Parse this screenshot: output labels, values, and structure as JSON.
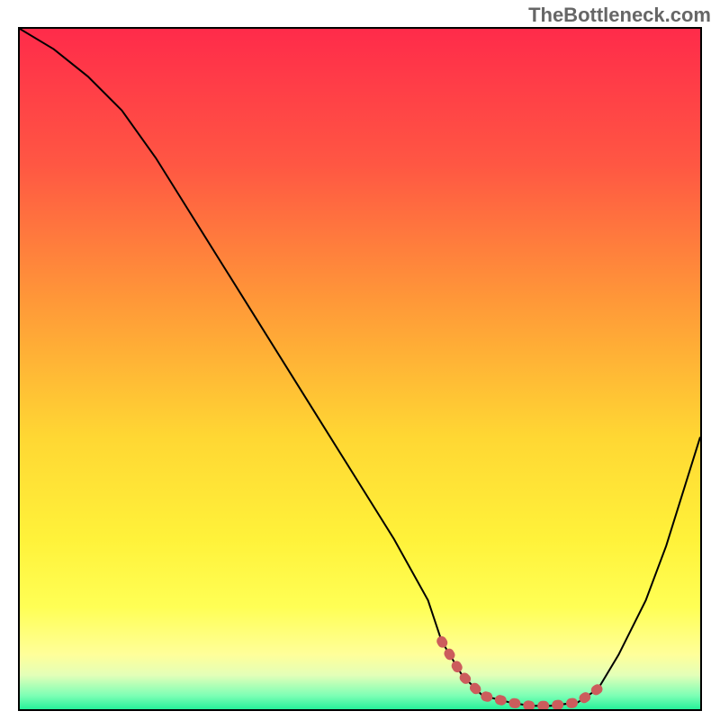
{
  "watermark": "TheBottleneck.com",
  "chart_data": {
    "type": "line",
    "title": "",
    "xlabel": "",
    "ylabel": "",
    "xlim": [
      0,
      100
    ],
    "ylim": [
      0,
      100
    ],
    "series": [
      {
        "name": "bottleneck-curve",
        "x": [
          0,
          5,
          10,
          15,
          20,
          25,
          30,
          35,
          40,
          45,
          50,
          55,
          60,
          62,
          65,
          68,
          72,
          75,
          78,
          82,
          85,
          88,
          92,
          95,
          100
        ],
        "values": [
          100,
          97,
          93,
          88,
          81,
          73,
          65,
          57,
          49,
          41,
          33,
          25,
          16,
          10,
          5,
          2,
          1,
          0.5,
          0.5,
          1,
          3,
          8,
          16,
          24,
          40
        ],
        "color": "#000000"
      },
      {
        "name": "optimal-zone",
        "x": [
          62,
          65,
          68,
          72,
          75,
          78,
          82,
          85
        ],
        "values": [
          10,
          5,
          2,
          1,
          0.5,
          0.5,
          1,
          3
        ],
        "color": "#cc5c5c"
      }
    ],
    "gradient_stops": [
      {
        "offset": 0,
        "color": "#ff2b4a"
      },
      {
        "offset": 20,
        "color": "#ff5743"
      },
      {
        "offset": 40,
        "color": "#ff9838"
      },
      {
        "offset": 60,
        "color": "#ffd733"
      },
      {
        "offset": 75,
        "color": "#fff23a"
      },
      {
        "offset": 85,
        "color": "#ffff55"
      },
      {
        "offset": 92,
        "color": "#ffff9a"
      },
      {
        "offset": 95,
        "color": "#e3ffb8"
      },
      {
        "offset": 98,
        "color": "#7dffb5"
      },
      {
        "offset": 100,
        "color": "#26f29a"
      }
    ]
  }
}
